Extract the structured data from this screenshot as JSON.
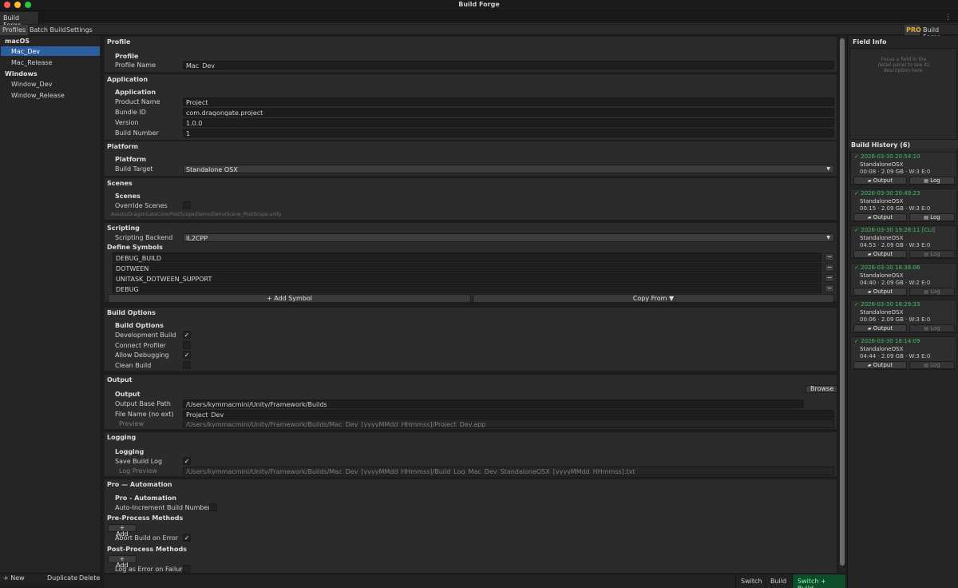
{
  "window": {
    "title": "Build Forge",
    "tab": "Build Forge",
    "menu_glyph": "⋮"
  },
  "toolbar": {
    "tabs": [
      "Profiles",
      "Batch Build",
      "Settings"
    ],
    "pro_badge": "PRO",
    "product_label": "Build Forge"
  },
  "sidebar": {
    "groups": [
      {
        "name": "macOS",
        "items": [
          "Mac_Dev",
          "Mac_Release"
        ]
      },
      {
        "name": "Windows",
        "items": [
          "Window_Dev",
          "Window_Release"
        ]
      }
    ],
    "selected": "Mac_Dev",
    "footer": {
      "new": "+ New",
      "duplicate": "Duplicate",
      "delete": "Delete"
    }
  },
  "profile": {
    "section": "Profile",
    "sub": "Profile",
    "name_label": "Profile Name",
    "name_value": "Mac_Dev"
  },
  "application": {
    "section": "Application",
    "sub": "Application",
    "product_label": "Product Name",
    "product_value": "Project",
    "bundle_label": "Bundle ID",
    "bundle_value": "com.dragongate.project",
    "version_label": "Version",
    "version_value": "1.0.0",
    "buildnum_label": "Build Number",
    "buildnum_value": "1"
  },
  "platform": {
    "section": "Platform",
    "sub": "Platform",
    "target_label": "Build Target",
    "target_value": "Standalone OSX"
  },
  "scenes": {
    "section": "Scenes",
    "sub": "Scenes",
    "override_label": "Override Scenes",
    "override_checked": false,
    "scene_path": "Assets/DragonGateCore/PostScope/Demo/DemoScene_PostScope.unity"
  },
  "scripting": {
    "section": "Scripting",
    "backend_label": "Scripting Backend",
    "backend_value": "IL2CPP",
    "define_header": "Define Symbols",
    "symbols": [
      "DEBUG_BUILD",
      "DOTWEEN",
      "UNITASK_DOTWEEN_SUPPORT",
      "DEBUG"
    ],
    "remove_glyph": "−",
    "add_symbol": "+ Add Symbol",
    "copy_from": "Copy From ▼"
  },
  "build_options": {
    "section": "Build Options",
    "sub": "Build Options",
    "items": [
      {
        "label": "Development Build",
        "checked": true
      },
      {
        "label": "Connect Profiler",
        "checked": false
      },
      {
        "label": "Allow Debugging",
        "checked": true
      },
      {
        "label": "Clean Build",
        "checked": false
      }
    ]
  },
  "output": {
    "section": "Output",
    "sub": "Output",
    "browse": "Browse",
    "base_label": "Output Base Path",
    "base_value": "/Users/kymmacmini/Unity/Framework/Builds",
    "file_label": "File Name (no ext)",
    "file_value": "Project_Dev",
    "preview_label": "Preview",
    "preview_value": "/Users/kymmacmini/Unity/Framework/Builds/Mac_Dev_[yyyyMMdd_HHmmss]/Project_Dev.app"
  },
  "logging": {
    "section": "Logging",
    "sub": "Logging",
    "save_label": "Save Build Log",
    "save_checked": true,
    "preview_label": "Log Preview",
    "preview_value": "/Users/kymmacmini/Unity/Framework/Builds/Mac_Dev_[yyyyMMdd_HHmmss]/Build_Log_Mac_Dev_StandaloneOSX_[yyyyMMdd_HHmmss].txt"
  },
  "automation": {
    "section": "Pro — Automation",
    "sub": "Pro - Automation",
    "auto_inc_label": "Auto-Increment Build Number",
    "auto_inc_checked": false,
    "pre_header": "Pre-Process Methods",
    "pre_add": "+ Add",
    "abort_label": "Abort Build on Error",
    "abort_checked": true,
    "post_header": "Post-Process Methods",
    "post_add": "+ Add",
    "log_err_label": "Log as Error on Failure",
    "log_err_checked": false
  },
  "actions": {
    "switch": "Switch",
    "build": "Build",
    "switch_build": "Switch + Build"
  },
  "field_info": {
    "title": "Field Info",
    "hint": "Focus a field in the detail panel to see its description here."
  },
  "history": {
    "title": "Build History (6)",
    "output_label": "Output",
    "log_label": "Log",
    "entries": [
      {
        "timestamp": "2026-03-30  20:54:10",
        "target": "StandaloneOSX",
        "stats": "00:08  ·  2.09 GB  ·  W:3  E:0",
        "log_enabled": true
      },
      {
        "timestamp": "2026-03-30  20:49:23",
        "target": "StandaloneOSX",
        "stats": "00:15  ·  2.09 GB  ·  W:3  E:0",
        "log_enabled": true
      },
      {
        "timestamp": "2026-03-30  19:26:11  [CLI]",
        "target": "StandaloneOSX",
        "stats": "04:53  ·  2.09 GB  ·  W:3  E:0",
        "log_enabled": false
      },
      {
        "timestamp": "2026-03-30  18:38:06",
        "target": "StandaloneOSX",
        "stats": "04:40  ·  2.09 GB  ·  W:2  E:0",
        "log_enabled": false
      },
      {
        "timestamp": "2026-03-30  18:29:33",
        "target": "StandaloneOSX",
        "stats": "00:06  ·  2.09 GB  ·  W:3  E:0",
        "log_enabled": false
      },
      {
        "timestamp": "2026-03-30  18:14:09",
        "target": "StandaloneOSX",
        "stats": "04:44  ·  2.09 GB  ·  W:3  E:0",
        "log_enabled": false
      }
    ]
  }
}
